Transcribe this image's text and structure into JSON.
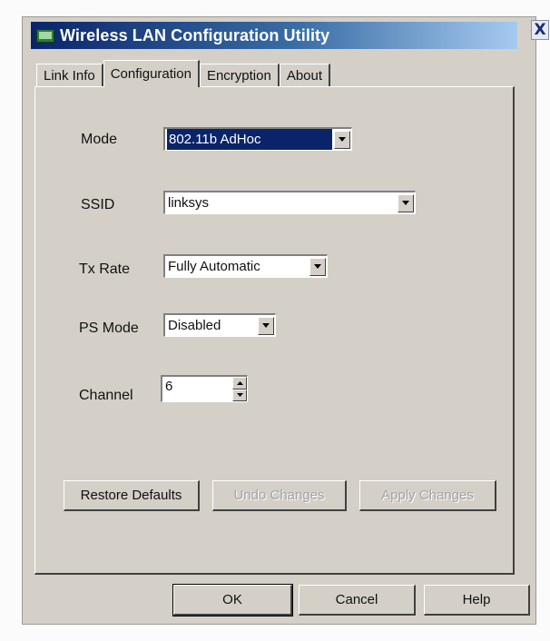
{
  "window": {
    "title": "Wireless LAN Configuration Utility",
    "close_glyph": "X"
  },
  "tabs": [
    {
      "label": "Link Info",
      "active": false
    },
    {
      "label": "Configuration",
      "active": true
    },
    {
      "label": "Encryption",
      "active": false
    },
    {
      "label": "About",
      "active": false
    }
  ],
  "form": {
    "mode": {
      "label": "Mode",
      "value": "802.11b AdHoc"
    },
    "ssid": {
      "label": "SSID",
      "value": "linksys"
    },
    "tx_rate": {
      "label": "Tx Rate",
      "value": "Fully Automatic"
    },
    "ps_mode": {
      "label": "PS Mode",
      "value": "Disabled"
    },
    "channel": {
      "label": "Channel",
      "value": "6"
    }
  },
  "actions": {
    "restore_defaults": "Restore Defaults",
    "undo_changes": "Undo Changes",
    "apply_changes": "Apply Changes"
  },
  "footer": {
    "ok": "OK",
    "cancel": "Cancel",
    "help": "Help"
  },
  "colors": {
    "selection": "#0a246a",
    "face": "#d4d0c8",
    "title_start": "#0a246a",
    "title_end": "#a6caf0"
  },
  "icons": {
    "app": "wireless-network-card-icon",
    "close": "close-icon",
    "dropdown": "chevron-down-icon",
    "spin_up": "spin-up-icon",
    "spin_down": "spin-down-icon"
  }
}
